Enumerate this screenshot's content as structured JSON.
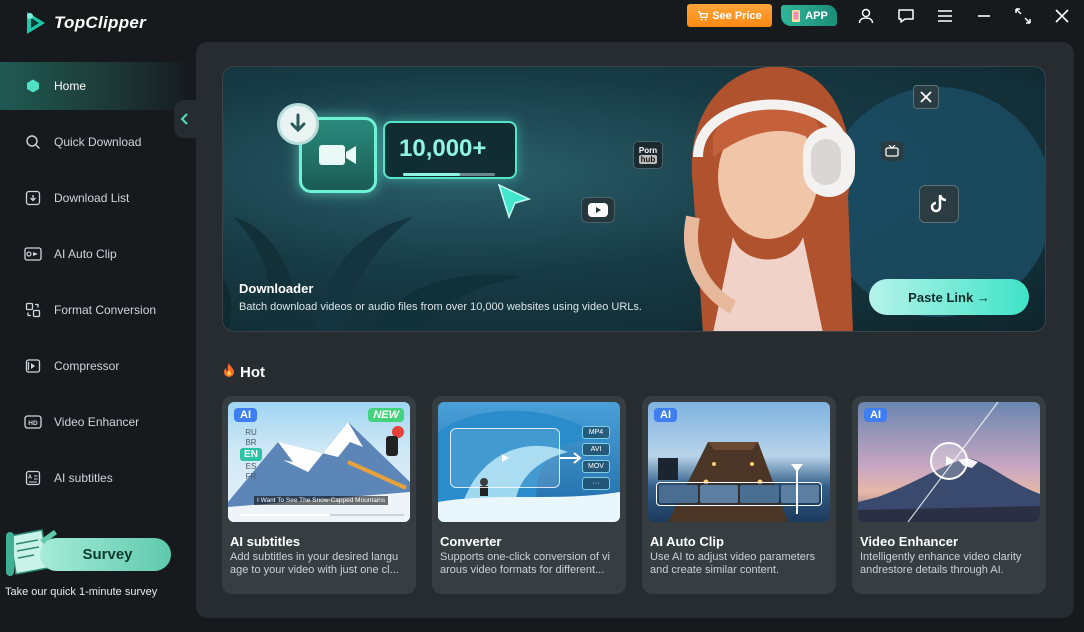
{
  "app": {
    "name": "TopClipper"
  },
  "titlebar": {
    "see_price": "See Price",
    "app_label": "APP"
  },
  "sidebar": {
    "items": [
      {
        "label": "Home",
        "icon": "home-icon",
        "active": true
      },
      {
        "label": "Quick Download",
        "icon": "search-icon"
      },
      {
        "label": "Download List",
        "icon": "download-list-icon"
      },
      {
        "label": "AI Auto Clip",
        "icon": "ai-clip-icon"
      },
      {
        "label": "Format Conversion",
        "icon": "format-conversion-icon"
      },
      {
        "label": "Compressor",
        "icon": "compressor-icon"
      },
      {
        "label": "Video Enhancer",
        "icon": "hd-icon"
      },
      {
        "label": "AI subtitles",
        "icon": "ai-subtitles-icon"
      }
    ],
    "survey": {
      "button": "Survey",
      "note": "Take our quick 1-minute survey"
    }
  },
  "banner": {
    "counter": "10,000+",
    "title": "Downloader",
    "description": "Batch download videos or audio files from over 10,000 websites using video URLs.",
    "paste_button": "Paste Link →",
    "platform_porn": "Porn",
    "platform_hub": "hub"
  },
  "hot": {
    "title": "Hot",
    "cards": [
      {
        "title": "AI subtitles",
        "desc1": "Add subtitles in your desired langu",
        "desc2": "age to your video with just one cl...",
        "badge": "AI",
        "new": "NEW",
        "langs": [
          "RU",
          "BR",
          "EN",
          "ES",
          "FR"
        ],
        "caption": "I Want To See The Snow-Capped Mountains"
      },
      {
        "title": "Converter",
        "desc1": "Supports one-click conversion of vi",
        "desc2": "arous video formats for different...",
        "formats": [
          "MP4",
          "AVI",
          "MOV",
          "···"
        ]
      },
      {
        "title": "AI Auto Clip",
        "desc1": "Use AI to adjust video parameters",
        "desc2": "and create similar content.",
        "badge": "AI"
      },
      {
        "title": "Video Enhancer",
        "desc1": "Intelligently enhance video clarity",
        "desc2": "andrestore details through AI.",
        "badge": "AI"
      }
    ]
  },
  "colors": {
    "accent": "#3fe3c6",
    "price": "#ff8a12",
    "ai_badge": "#3e7ef0",
    "new_badge": "#42d27b"
  }
}
